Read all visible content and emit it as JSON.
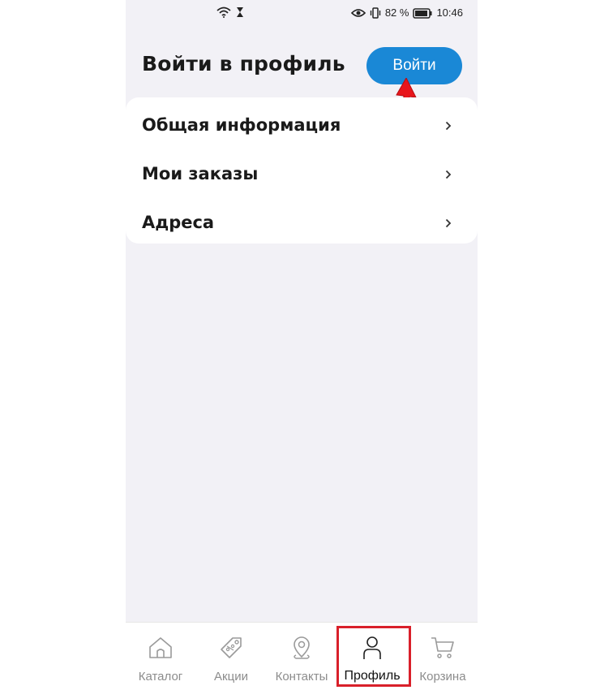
{
  "status_bar": {
    "battery_percent": "82 %",
    "time": "10:46"
  },
  "header": {
    "title": "Войти в профиль",
    "login_button_label": "Войти"
  },
  "menu": {
    "items": [
      {
        "label": "Общая информация",
        "icon": "chevron-right-icon"
      },
      {
        "label": "Мои заказы",
        "icon": "chevron-right-icon"
      },
      {
        "label": "Адреса",
        "icon": "chevron-right-icon"
      }
    ]
  },
  "tab_bar": {
    "tabs": [
      {
        "label": "Каталог",
        "icon": "home-icon",
        "active": false
      },
      {
        "label": "Акции",
        "icon": "tag-icon",
        "active": false
      },
      {
        "label": "Контакты",
        "icon": "location-pin-icon",
        "active": false
      },
      {
        "label": "Профиль",
        "icon": "person-icon",
        "active": true
      },
      {
        "label": "Корзина",
        "icon": "cart-icon",
        "active": false
      }
    ]
  },
  "colors": {
    "accent": "#1a88d6",
    "background": "#f2f1f6",
    "annotation": "#d9202a"
  }
}
